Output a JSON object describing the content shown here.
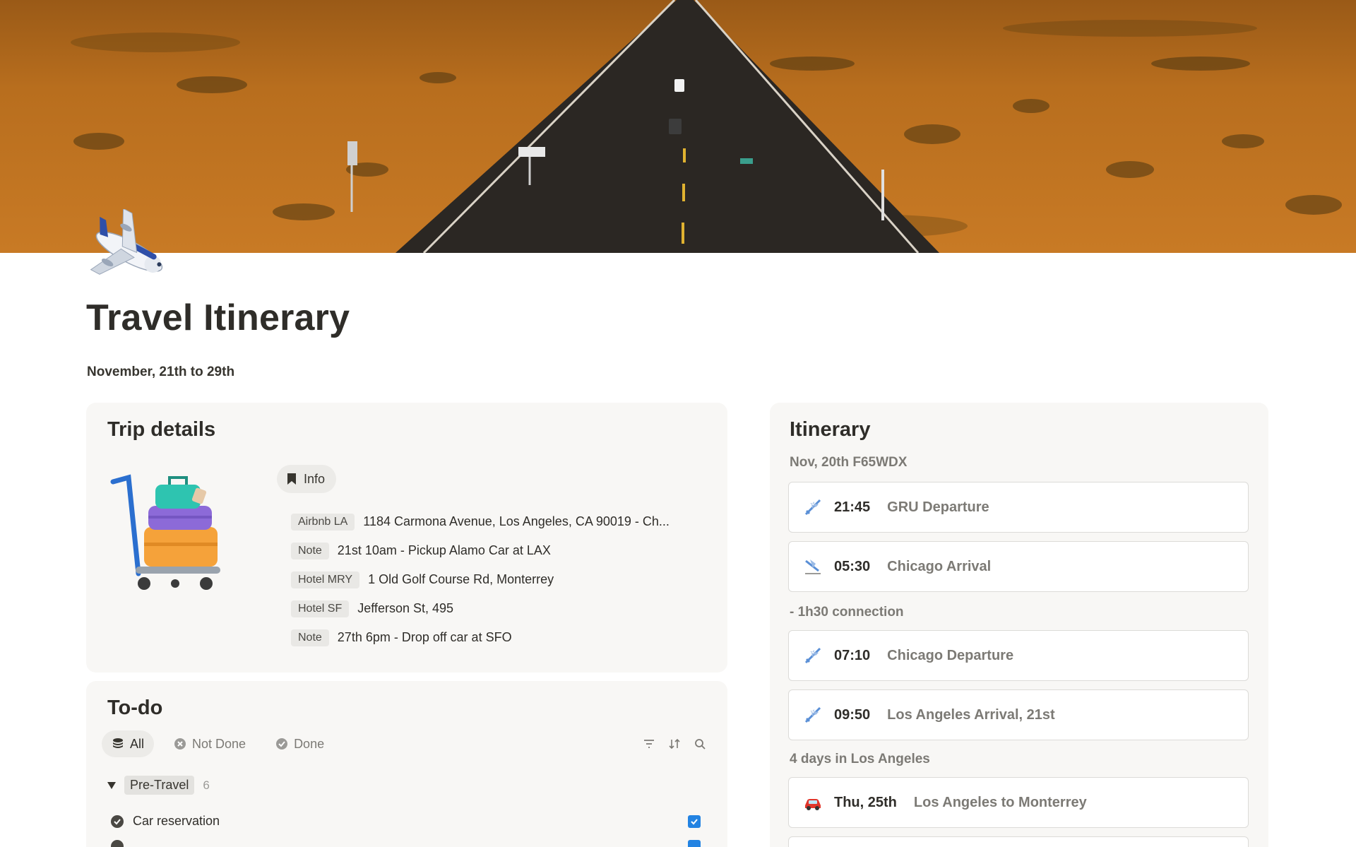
{
  "page": {
    "title": "Travel Itinerary",
    "subtitle": "November, 21th to 29th",
    "icon": "airplane-icon"
  },
  "trip_details": {
    "heading": "Trip details",
    "tab_label": "Info",
    "tab_icon": "bookmark-icon",
    "rows": [
      {
        "tag": "Airbnb LA",
        "text": "1184 Carmona Avenue, Los Angeles, CA 90019 - Ch..."
      },
      {
        "tag": "Note",
        "text": "21st 10am - Pickup Alamo Car at LAX"
      },
      {
        "tag": "Hotel MRY",
        "text": "1 Old Golf Course Rd, Monterrey"
      },
      {
        "tag": "Hotel SF",
        "text": "Jefferson St, 495"
      },
      {
        "tag": "Note",
        "text": "27th 6pm - Drop off car at SFO"
      }
    ]
  },
  "todo": {
    "heading": "To-do",
    "filters": [
      {
        "label": "All",
        "icon": "stack-icon",
        "active": true
      },
      {
        "label": "Not Done",
        "icon": "x-circle-icon",
        "active": false
      },
      {
        "label": "Done",
        "icon": "check-circle-icon",
        "active": false
      }
    ],
    "tools": [
      "filter-icon",
      "sort-icon",
      "search-icon"
    ],
    "group": {
      "label": "Pre-Travel",
      "count": "6"
    },
    "tasks": [
      {
        "label": "Car reservation",
        "done": true
      },
      {
        "label": "",
        "done": true
      }
    ]
  },
  "itinerary": {
    "heading": "Itinerary",
    "sections": [
      {
        "label": "Nov, 20th F65WDX"
      },
      {
        "label": "- 1h30 connection"
      },
      {
        "label": "4 days in Los Angeles"
      }
    ],
    "items": [
      {
        "emoji": "airplane-departure-icon",
        "time": "21:45",
        "label": "GRU Departure"
      },
      {
        "emoji": "airplane-arrival-icon",
        "time": "05:30",
        "label": "Chicago Arrival"
      },
      {
        "emoji": "airplane-departure-icon",
        "time": "07:10",
        "label": "Chicago Departure"
      },
      {
        "emoji": "airplane-departure-icon",
        "time": "09:50",
        "label": "Los Angeles Arrival, 21st"
      },
      {
        "emoji": "car-icon",
        "time": "Thu, 25th",
        "label": "Los Angeles to Monterrey"
      }
    ]
  },
  "colors": {
    "accent": "#2383e2",
    "card_bg": "#f8f7f5",
    "muted_text": "#7c7a75"
  }
}
